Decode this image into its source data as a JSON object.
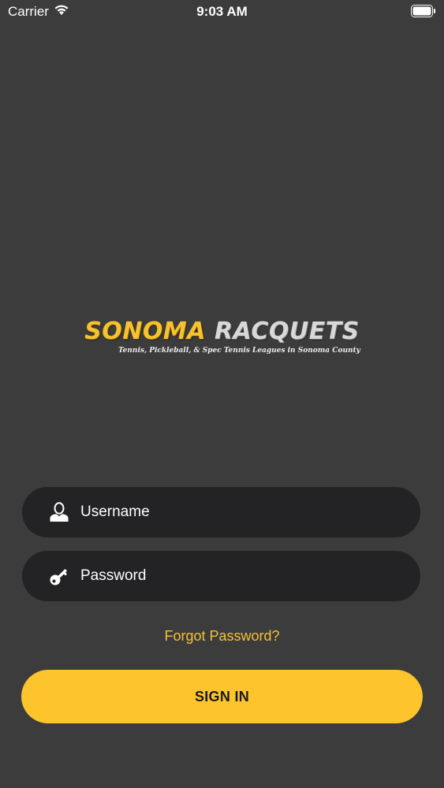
{
  "status_bar": {
    "carrier": "Carrier",
    "time": "9:03 AM"
  },
  "logo": {
    "word_1": "SONOMA",
    "word_2": "RACQUETS",
    "tagline": "Tennis, Pickleball, & Spec Tennis Leagues in Sonoma County"
  },
  "login": {
    "username_placeholder": "Username",
    "password_placeholder": "Password",
    "forgot_password": "Forgot Password?",
    "sign_in": "SIGN IN"
  },
  "colors": {
    "background": "#3d3c3d",
    "field_background": "#232224",
    "accent": "#fdc42c"
  },
  "icons": {
    "username": "user-icon",
    "password": "key-icon"
  }
}
